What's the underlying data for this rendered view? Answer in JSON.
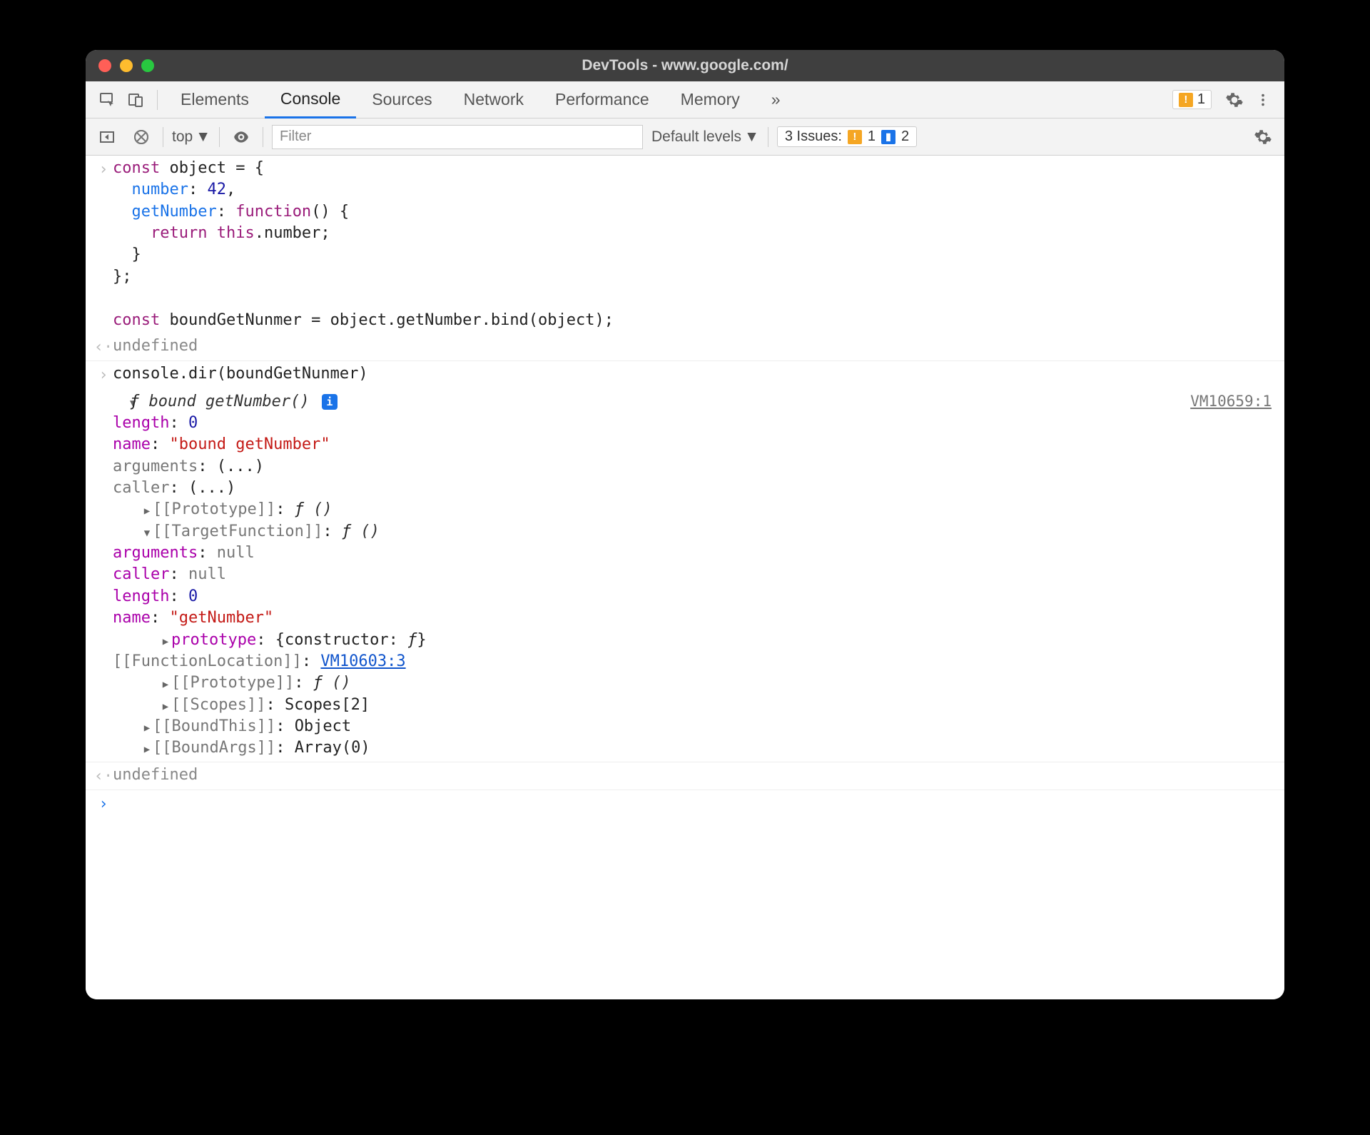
{
  "window": {
    "title": "DevTools - www.google.com/"
  },
  "tabs": {
    "items": [
      "Elements",
      "Console",
      "Sources",
      "Network",
      "Performance",
      "Memory"
    ],
    "active_index": 1,
    "overflow": "»",
    "warn_count": "1"
  },
  "toolbar": {
    "context": "top",
    "filter_placeholder": "Filter",
    "levels": "Default levels",
    "issues_label": "3 Issues:",
    "issues_warn": "1",
    "issues_info": "2"
  },
  "code": {
    "line1": "const object = {",
    "line2": "  number: 42,",
    "line3": "  getNumber: function() {",
    "line4": "    return this.number;",
    "line5": "  }",
    "line6": "};",
    "line7": "",
    "line8": "const boundGetNunmer = object.getNumber.bind(object);"
  },
  "result1": "undefined",
  "cmd2": "console.dir(boundGetNunmer)",
  "dir": {
    "header_f": "ƒ",
    "header_sig": " bound getNumber()",
    "src": "VM10659:1",
    "length_k": "length",
    "length_v": "0",
    "name_k": "name",
    "name_v": "\"bound getNumber\"",
    "arguments_k": "arguments",
    "arguments_v": "(...)",
    "caller_k": "caller",
    "caller_v": "(...)",
    "proto_k": "[[Prototype]]",
    "proto_v_f": "ƒ",
    "proto_v_sig": " ()",
    "target_k": "[[TargetFunction]]",
    "target_v_f": "ƒ",
    "target_v_sig": " ()",
    "t_arguments_k": "arguments",
    "t_arguments_v": "null",
    "t_caller_k": "caller",
    "t_caller_v": "null",
    "t_length_k": "length",
    "t_length_v": "0",
    "t_name_k": "name",
    "t_name_v": "\"getNumber\"",
    "t_prototype_k": "prototype",
    "t_prototype_v": "{constructor: ƒ}",
    "t_funcLoc_k": "[[FunctionLocation]]",
    "t_funcLoc_v": "VM10603:3",
    "t_proto_k": "[[Prototype]]",
    "t_proto_v_f": "ƒ",
    "t_proto_v_sig": " ()",
    "t_scopes_k": "[[Scopes]]",
    "t_scopes_v": "Scopes[2]",
    "boundThis_k": "[[BoundThis]]",
    "boundThis_v": "Object",
    "boundArgs_k": "[[BoundArgs]]",
    "boundArgs_v": "Array(0)"
  },
  "result2": "undefined",
  "tokens": {
    "const": "const",
    "object": " object ",
    "eq_open": "= {",
    "number_k": "number",
    "colon_sp": ": ",
    "num42": "42",
    "comma": ",",
    "getNumber_k": "getNumber",
    "func": "function",
    "parens_open": "() {",
    "return": "return",
    "this": "this",
    "dot_num_semi": ".number;",
    "close_brace": "}",
    "close_line": "};",
    "bound_var": " boundGetNunmer ",
    "eq": "= ",
    "bind_expr": "object.getNumber.bind(object);"
  }
}
